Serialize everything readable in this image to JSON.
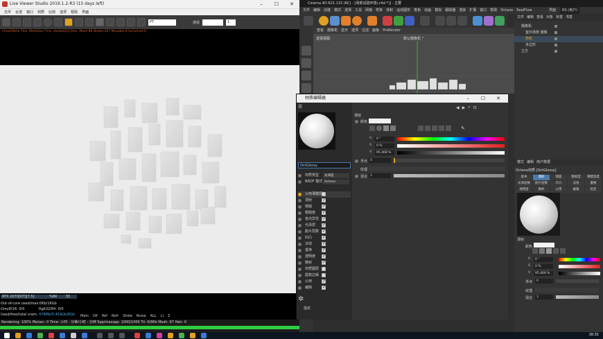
{
  "live_viewer": {
    "title": "Live Viewer Studio 2019.1.2-R3 (15 days left)",
    "menu": [
      "文件",
      "云渲",
      "窗口",
      "材质",
      "比较",
      "选项",
      "帮助",
      "界面"
    ],
    "toolbar": {
      "pt_select": "PT",
      "mode_label": "通道",
      "value": "1"
    },
    "status_line": "CheckStms:7ms. MeshGen:7ms. Update[G]:0ms. Mesh:86 Nodes:207 Movable:0 txCached:0",
    "gpu": {
      "name": "RTX 2070[DT][7.5]",
      "usage_pct": "%84",
      "temp": "55",
      "outofcore": "Out-of-core used/max:0Kb/16Gb",
      "grey": "Grey8/16: 0/0",
      "rgb": "Rgb32/64: 0/0",
      "vram_label": "Used/free/total vram:",
      "vram_value": "978Mb/5.454Gb/8Gb",
      "tabs": [
        "Main",
        "Dif",
        "Ref",
        "Refr",
        "Shdw",
        "Noise",
        "ALL",
        "LI",
        "Z"
      ]
    },
    "stats": "Rendering: 100%   Ms/sec: 0   Time: 小时 : 分钟/小时 : 分钟   Spp/maxspp: 1000/1000  Tri: 0/96k   Mesh: 97   Hair: 0",
    "progress": 1.0
  },
  "c4d": {
    "title": "Cinema 4D R21.115 (RC) - [场景试验环境(.c4d *)] - 主要",
    "menu": [
      "文件",
      "编辑",
      "创建",
      "模式",
      "选择",
      "工具",
      "网格",
      "样条",
      "体积",
      "运动图形",
      "角色",
      "动画",
      "模拟",
      "跟踪器",
      "渲染",
      "扩展",
      "窗口",
      "帮助",
      "Octane",
      "RealFlow"
    ],
    "layout_label": "界面",
    "layout_value": "RS (用户)",
    "viewport_menu": [
      "查看",
      "摄像机",
      "显示",
      "选项",
      "过滤",
      "面板",
      "ProRender"
    ],
    "viewport_label": "透视视图",
    "camera_label": "默认摄像机 °",
    "object_manager": {
      "menu": [
        "文件",
        "编辑",
        "查看",
        "对象",
        "标签",
        "书签"
      ],
      "rows": [
        {
          "name": "摄像机",
          "indent": 0
        },
        {
          "name": "室外场景 摄像",
          "indent": 1
        },
        {
          "name": "随机",
          "indent": 1
        },
        {
          "name": "多边形",
          "indent": 1
        },
        {
          "name": "立方",
          "indent": 0
        }
      ]
    },
    "attribute_manager": {
      "header": [
        "模式",
        "编辑",
        "用户数据"
      ],
      "material_label": "Octane材质 [OctGlossy]",
      "tabs_row1": [
        "基本",
        "漫射",
        "镜面",
        "粗糙度",
        "薄膜宽度"
      ],
      "tabs_row2": [
        "光泽层数",
        "胶片层数",
        "凹凸",
        "法线",
        "置换"
      ],
      "tabs_row3": [
        "透明度",
        "散射",
        "公用",
        "编辑",
        "指定"
      ],
      "active_tab": "漫射",
      "section": "漫射",
      "color_label": "颜色",
      "h": "0 °",
      "s": "0 %",
      "v": "95.469 %",
      "float_label": "浮点",
      "float_value": "0",
      "texture_label": "纹理",
      "mix_label": "混合",
      "mix_value": "1."
    }
  },
  "material_editor": {
    "title": "材质编辑器",
    "material_name": "OctGlossy",
    "channels_top": [
      {
        "label": "材质类型",
        "value": "光泽度"
      },
      {
        "label": "BRDF 模式",
        "value": "Octane"
      }
    ],
    "channels": [
      {
        "label": "公用薄膜层",
        "checked": false,
        "active": true
      },
      {
        "label": "漫射",
        "checked": true
      },
      {
        "label": "镜面",
        "checked": true
      },
      {
        "label": "粗糙度",
        "checked": true
      },
      {
        "label": "各向异性",
        "checked": true
      },
      {
        "label": "光泽层",
        "checked": true
      },
      {
        "label": "胶片层数",
        "checked": true
      },
      {
        "label": "凹凸",
        "checked": true
      },
      {
        "label": "法线",
        "checked": true
      },
      {
        "label": "置换",
        "checked": true
      },
      {
        "label": "透明度",
        "checked": true
      },
      {
        "label": "散射",
        "checked": true
      },
      {
        "label": "材质图层",
        "checked": false
      },
      {
        "label": "圆角边缘",
        "checked": false
      },
      {
        "label": "公用",
        "checked": true
      },
      {
        "label": "编辑",
        "checked": true
      }
    ],
    "bottom_label": "指定",
    "section": "漫射",
    "color_label": "颜色",
    "h": "0 °",
    "s": "0 %",
    "v": "95.469 %",
    "float_label": "浮点",
    "float_value": "0",
    "texture_label": "纹理",
    "mix_label": "混合",
    "mix_value": "1."
  },
  "taskbar": {
    "clock": "16:31"
  }
}
